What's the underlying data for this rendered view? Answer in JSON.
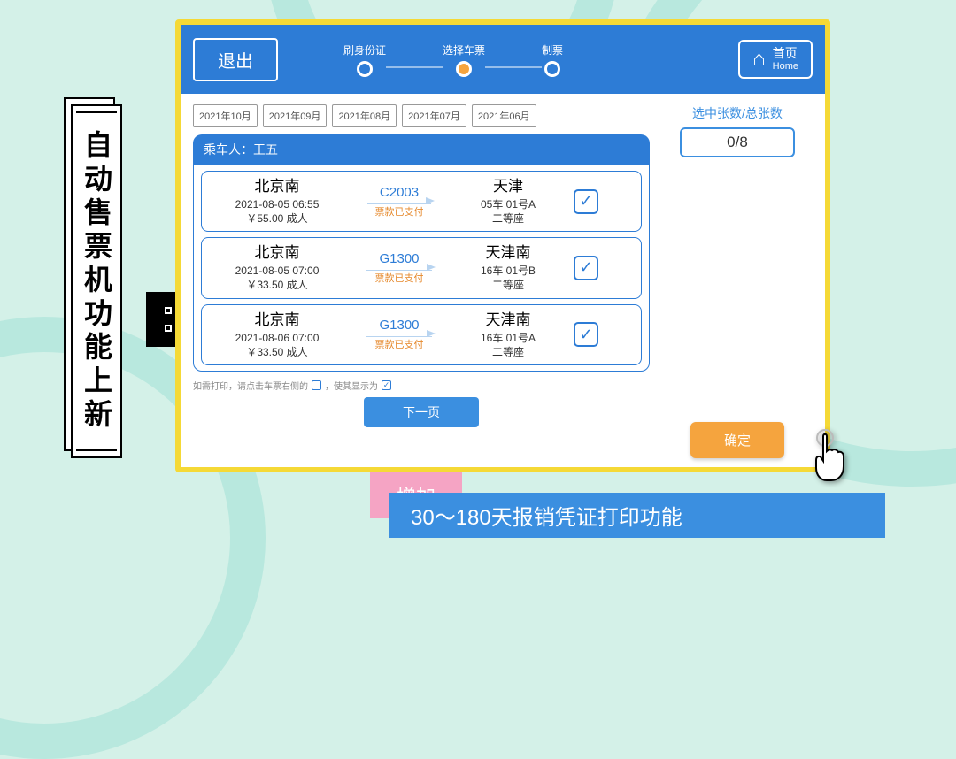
{
  "side_title": "自动售票机功能上新",
  "header": {
    "exit": "退出",
    "steps": [
      "刷身份证",
      "选择车票",
      "制票"
    ],
    "home": {
      "cn": "首页",
      "en": "Home"
    }
  },
  "months": [
    "2021年10月",
    "2021年09月",
    "2021年08月",
    "2021年07月",
    "2021年06月"
  ],
  "passenger_prefix": "乘车人：",
  "passenger_name": "王五",
  "tickets": [
    {
      "from": "北京南",
      "datetime": "2021-08-05 06:55",
      "price": "￥55.00 成人",
      "train": "C2003",
      "paid": "票款已支付",
      "to": "天津",
      "seat": "05车 01号A",
      "class": "二等座"
    },
    {
      "from": "北京南",
      "datetime": "2021-08-05 07:00",
      "price": "￥33.50 成人",
      "train": "G1300",
      "paid": "票款已支付",
      "to": "天津南",
      "seat": "16车 01号B",
      "class": "二等座"
    },
    {
      "from": "北京南",
      "datetime": "2021-08-06 07:00",
      "price": "￥33.50 成人",
      "train": "G1300",
      "paid": "票款已支付",
      "to": "天津南",
      "seat": "16车 01号A",
      "class": "二等座"
    }
  ],
  "hint": {
    "pre": "如需打印，请点击车票右侧的",
    "post": "，使其显示为"
  },
  "next_page": "下一页",
  "right": {
    "label": "选中张数/总张数",
    "count": "0/8",
    "confirm": "确定"
  },
  "decor": {
    "add": "增加",
    "banner": "30～180天报销凭证打印功能"
  }
}
